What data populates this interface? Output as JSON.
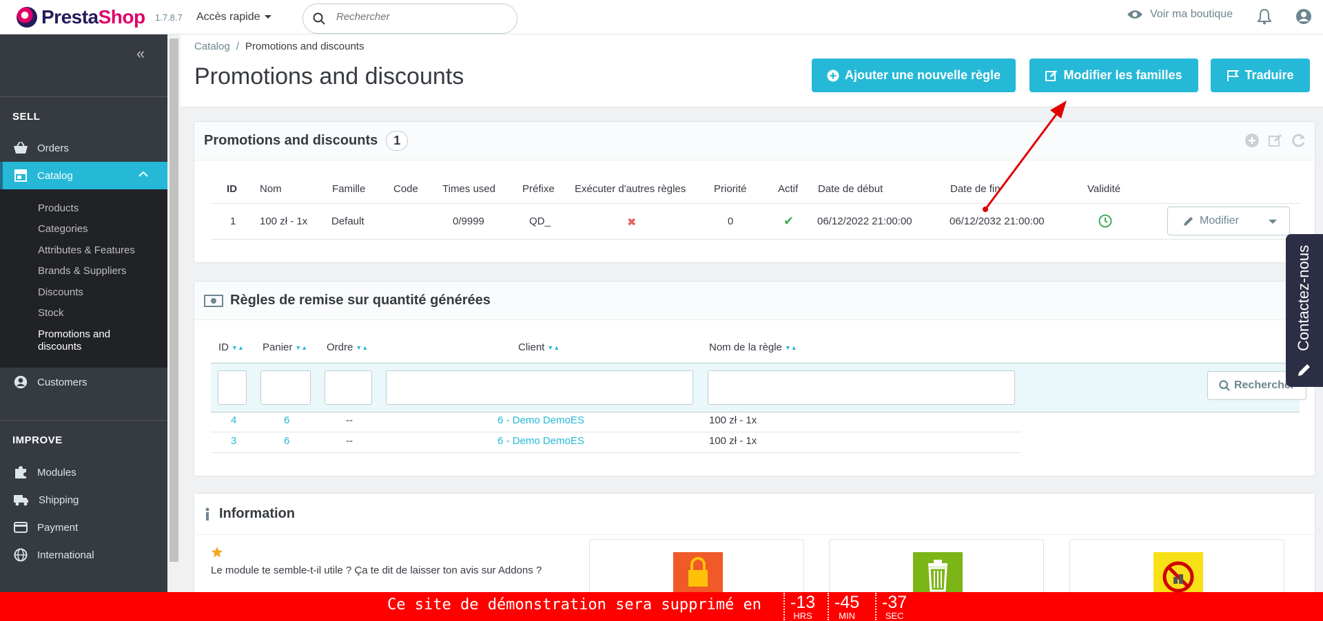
{
  "header": {
    "brand_prefix": "Presta",
    "brand_suffix": "Shop",
    "version": "1.7.8.7",
    "quick_access": "Accès rapide",
    "search_placeholder": "Rechercher",
    "view_shop": "Voir ma boutique"
  },
  "sidebar": {
    "collapse": "«",
    "sell_title": "SELL",
    "improve_title": "IMPROVE",
    "orders": "Orders",
    "catalog": "Catalog",
    "catalog_sub": [
      "Products",
      "Categories",
      "Attributes & Features",
      "Brands & Suppliers",
      "Discounts",
      "Stock",
      "Promotions and discounts"
    ],
    "customers": "Customers",
    "modules": "Modules",
    "shipping": "Shipping",
    "payment": "Payment",
    "international": "International"
  },
  "breadcrumb": {
    "parent": "Catalog",
    "sep": "/",
    "current": "Promotions and discounts"
  },
  "page": {
    "title": "Promotions and discounts",
    "btn_add": "Ajouter une nouvelle règle",
    "btn_families": "Modifier les familles",
    "btn_translate": "Traduire"
  },
  "rules_panel": {
    "title": "Promotions and discounts",
    "count": "1",
    "columns": [
      "ID",
      "Nom",
      "Famille",
      "Code",
      "Times used",
      "Préfixe",
      "Exécuter d'autres règles",
      "Priorité",
      "Actif",
      "Date de début",
      "Date de fin",
      "Validité"
    ],
    "row": {
      "id": "1",
      "name": "100 zł - 1x",
      "family": "Default",
      "code": "",
      "times_used": "0/9999",
      "prefix": "QD_",
      "run_other": "✖",
      "priority": "0",
      "active": "✔",
      "date_start": "06/12/2022 21:00:00",
      "date_end": "06/12/2032 21:00:00"
    },
    "btn_modify": "Modifier"
  },
  "generated_panel": {
    "title": "Règles de remise sur quantité générées",
    "columns": [
      "ID",
      "Panier",
      "Ordre",
      "Client",
      "Nom de la règle"
    ],
    "btn_search": "Rechercher",
    "rows": [
      {
        "id": "4",
        "cart": "6",
        "order": "--",
        "client": "6 - Demo DemoES",
        "rule": "100 zł - 1x"
      },
      {
        "id": "3",
        "cart": "6",
        "order": "--",
        "client": "6 - Demo DemoES",
        "rule": "100 zł - 1x"
      }
    ]
  },
  "info_panel": {
    "title": "Information",
    "review_text": "Le module te semble-t-il utile ? Ça te dit de laisser ton avis sur Addons ?"
  },
  "contact_tab": "Contactez-nous",
  "banner": {
    "message": "Ce site de démonstration sera supprimé en",
    "hours": "-13",
    "hours_unit": "HRS",
    "minutes": "-45",
    "minutes_unit": "MIN",
    "seconds": "-37",
    "seconds_unit": "SEC"
  },
  "colors": {
    "accent": "#25b9d7",
    "sidebar": "#363a41",
    "banner": "#ff0000",
    "arrow": "#e00000"
  }
}
